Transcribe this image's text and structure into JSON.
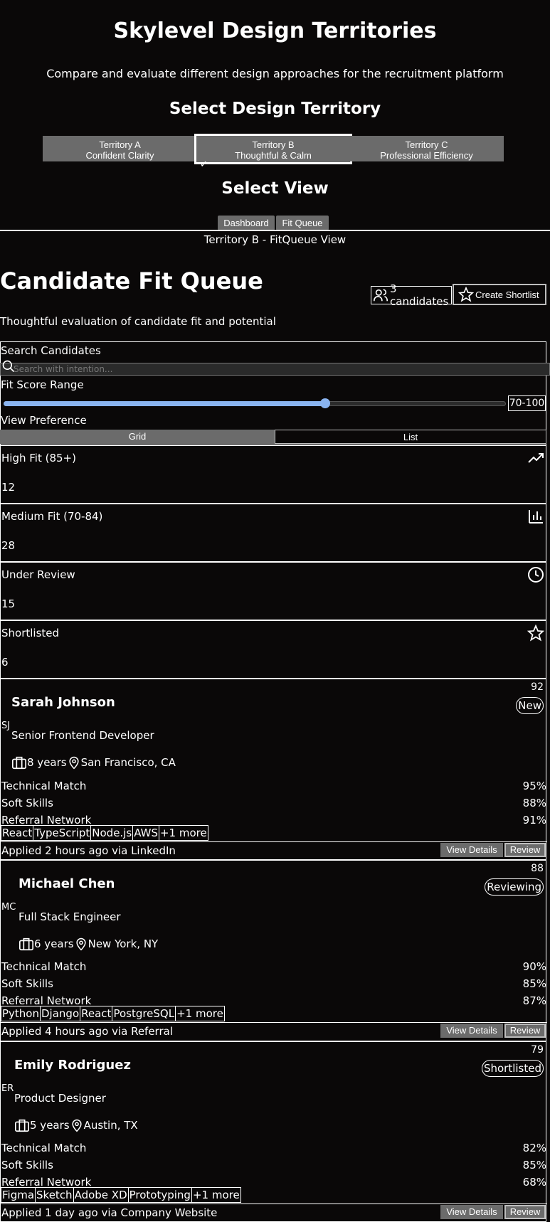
{
  "header": {
    "title": "Skylevel Design Territories",
    "subtitle": "Compare and evaluate different design approaches for the recruitment platform"
  },
  "territory": {
    "heading": "Select Design Territory",
    "options": [
      {
        "name": "Territory A",
        "desc": "Confident Clarity"
      },
      {
        "name": "Territory B",
        "desc": "Thoughtful & Calm"
      },
      {
        "name": "Territory C",
        "desc": "Professional Efficiency"
      }
    ],
    "selected_mark": "✓"
  },
  "view": {
    "heading": "Select View",
    "options": [
      "Dashboard",
      "Fit Queue"
    ],
    "current_label": "Territory B - FitQueue View"
  },
  "fitqueue": {
    "title": "Candidate Fit Queue",
    "tagline": "Thoughtful evaluation of candidate fit and potential",
    "candidate_count": "3 candidates",
    "create_shortlist": "Create Shortlist"
  },
  "filters": {
    "search_label": "Search Candidates",
    "search_placeholder": "Search with intention...",
    "range_label": "Fit Score Range",
    "range_value": "70-100",
    "range_fill_fraction": 0.64,
    "view_pref_label": "View Preference",
    "view_pref_options": [
      "Grid",
      "List"
    ]
  },
  "stats": [
    {
      "label": "High Fit (85+)",
      "value": "12",
      "icon": "trending-up-icon"
    },
    {
      "label": "Medium Fit (70-84)",
      "value": "28",
      "icon": "bar-chart-icon"
    },
    {
      "label": "Under Review",
      "value": "15",
      "icon": "clock-icon"
    },
    {
      "label": "Shortlisted",
      "value": "6",
      "icon": "star-icon"
    }
  ],
  "candidates": [
    {
      "score": "92",
      "status": "New",
      "name": "Sarah Johnson",
      "initials": "SJ",
      "role": "Senior Frontend Developer",
      "experience": "8 years",
      "location": "San Francisco, CA",
      "metrics": [
        {
          "label": "Technical Match",
          "value": "95%"
        },
        {
          "label": "Soft Skills",
          "value": "88%"
        },
        {
          "label": "Referral Network",
          "value": "91%"
        }
      ],
      "skills": [
        "React",
        "TypeScript",
        "Node.js",
        "AWS",
        "+1 more"
      ],
      "applied": "Applied 2 hours ago via LinkedIn"
    },
    {
      "score": "88",
      "status": "Reviewing",
      "name": "Michael Chen",
      "initials": "MC",
      "role": "Full Stack Engineer",
      "experience": "6 years",
      "location": "New York, NY",
      "metrics": [
        {
          "label": "Technical Match",
          "value": "90%"
        },
        {
          "label": "Soft Skills",
          "value": "85%"
        },
        {
          "label": "Referral Network",
          "value": "87%"
        }
      ],
      "skills": [
        "Python",
        "Django",
        "React",
        "PostgreSQL",
        "+1 more"
      ],
      "applied": "Applied 4 hours ago via Referral"
    },
    {
      "score": "79",
      "status": "Shortlisted",
      "name": "Emily Rodriguez",
      "initials": "ER",
      "role": "Product Designer",
      "experience": "5 years",
      "location": "Austin, TX",
      "metrics": [
        {
          "label": "Technical Match",
          "value": "82%"
        },
        {
          "label": "Soft Skills",
          "value": "85%"
        },
        {
          "label": "Referral Network",
          "value": "68%"
        }
      ],
      "skills": [
        "Figma",
        "Sketch",
        "Adobe XD",
        "Prototyping",
        "+1 more"
      ],
      "applied": "Applied 1 day ago via Company Website"
    }
  ],
  "card_actions": {
    "view_details": "View Details",
    "review": "Review"
  }
}
